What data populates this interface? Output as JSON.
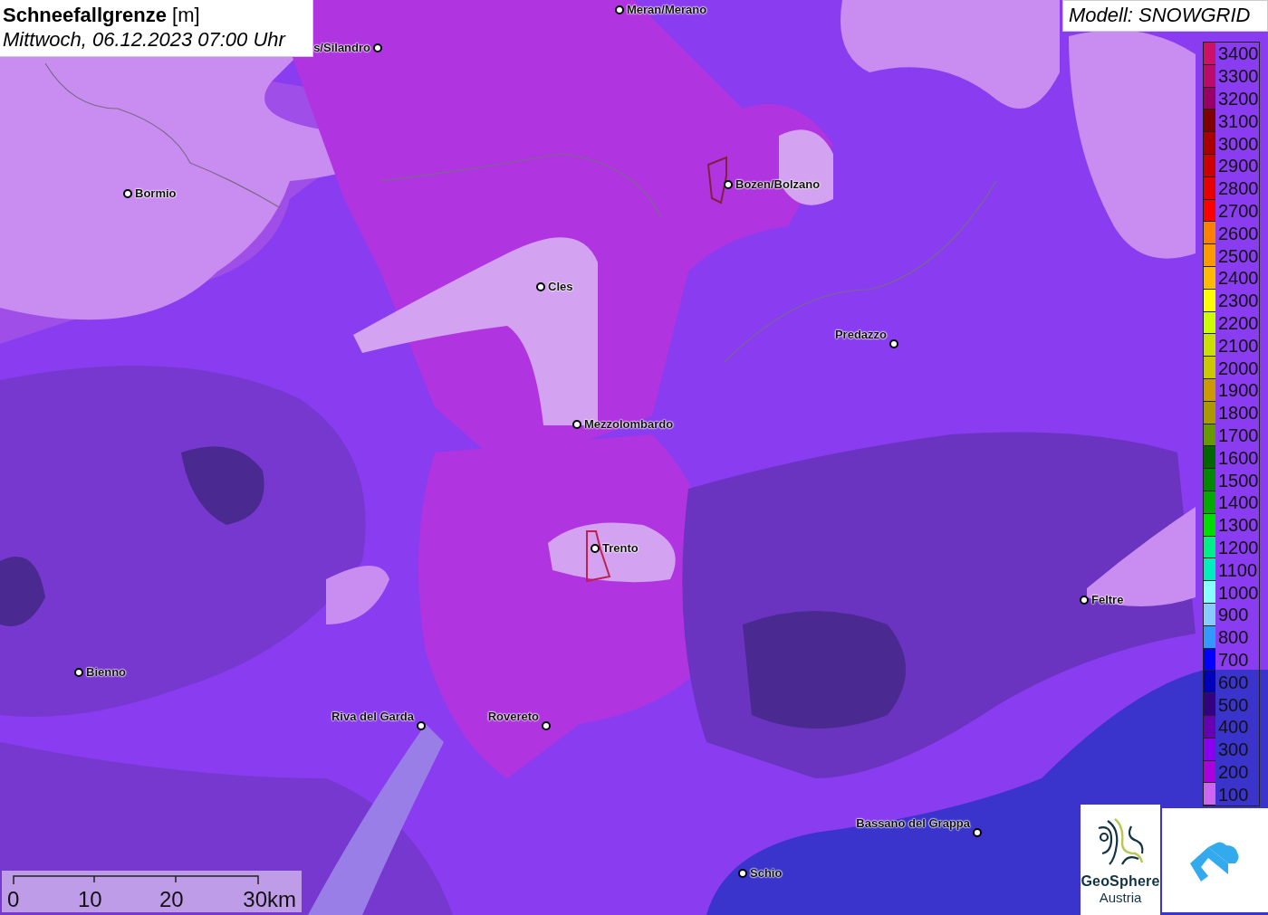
{
  "title": {
    "name": "Schneefallgrenze",
    "unit": "[m]",
    "datetime": "Mittwoch, 06.12.2023 07:00 Uhr"
  },
  "model": "Modell: SNOWGRID",
  "places": [
    {
      "name": "Meran/Merano",
      "kind": "city"
    },
    {
      "name": "s/Silandro",
      "kind": "city"
    },
    {
      "name": "Bormio",
      "kind": "city"
    },
    {
      "name": "Bozen/Bolzano",
      "kind": "city"
    },
    {
      "name": "Cles",
      "kind": "city"
    },
    {
      "name": "Predazzo",
      "kind": "city"
    },
    {
      "name": "Mezzolombardo",
      "kind": "city"
    },
    {
      "name": "Trento",
      "kind": "city"
    },
    {
      "name": "Feltre",
      "kind": "city"
    },
    {
      "name": "Bienno",
      "kind": "city"
    },
    {
      "name": "Riva del Garda",
      "kind": "city"
    },
    {
      "name": "Rovereto",
      "kind": "city"
    },
    {
      "name": "Bassano del Grappa",
      "kind": "city"
    },
    {
      "name": "Schio",
      "kind": "city"
    }
  ],
  "legend": [
    {
      "label": "3400",
      "color": "#cc1166"
    },
    {
      "label": "3300",
      "color": "#bb0c6c"
    },
    {
      "label": "3200",
      "color": "#990066"
    },
    {
      "label": "3100",
      "color": "#800000"
    },
    {
      "label": "3000",
      "color": "#aa0000"
    },
    {
      "label": "2900",
      "color": "#cc0000"
    },
    {
      "label": "2800",
      "color": "#e60000"
    },
    {
      "label": "2700",
      "color": "#ff0000"
    },
    {
      "label": "2600",
      "color": "#ff8000"
    },
    {
      "label": "2500",
      "color": "#ff9900"
    },
    {
      "label": "2400",
      "color": "#ffbb00"
    },
    {
      "label": "2300",
      "color": "#ffff00"
    },
    {
      "label": "2200",
      "color": "#ccff00"
    },
    {
      "label": "2100",
      "color": "#cce000"
    },
    {
      "label": "2000",
      "color": "#ccc800"
    },
    {
      "label": "1900",
      "color": "#cc9900"
    },
    {
      "label": "1800",
      "color": "#aa9900"
    },
    {
      "label": "1700",
      "color": "#669900"
    },
    {
      "label": "1600",
      "color": "#006600"
    },
    {
      "label": "1500",
      "color": "#008800"
    },
    {
      "label": "1400",
      "color": "#00aa00"
    },
    {
      "label": "1300",
      "color": "#00dd00"
    },
    {
      "label": "1200",
      "color": "#00ee88"
    },
    {
      "label": "1100",
      "color": "#00eebb"
    },
    {
      "label": "1000",
      "color": "#88ffff"
    },
    {
      "label": "900",
      "color": "#88ccff"
    },
    {
      "label": "800",
      "color": "#3399ff"
    },
    {
      "label": "700",
      "color": "#0000ff"
    },
    {
      "label": "600",
      "color": "#0000bb"
    },
    {
      "label": "500",
      "color": "#330080"
    },
    {
      "label": "400",
      "color": "#6600b0"
    },
    {
      "label": "300",
      "color": "#8800ee"
    },
    {
      "label": "200",
      "color": "#aa00dd"
    },
    {
      "label": "100",
      "color": "#cc66ee"
    }
  ],
  "scale": [
    "0",
    "10",
    "20",
    "30km"
  ],
  "logo": {
    "line1": "GeoSphere",
    "line2": "Austria"
  }
}
